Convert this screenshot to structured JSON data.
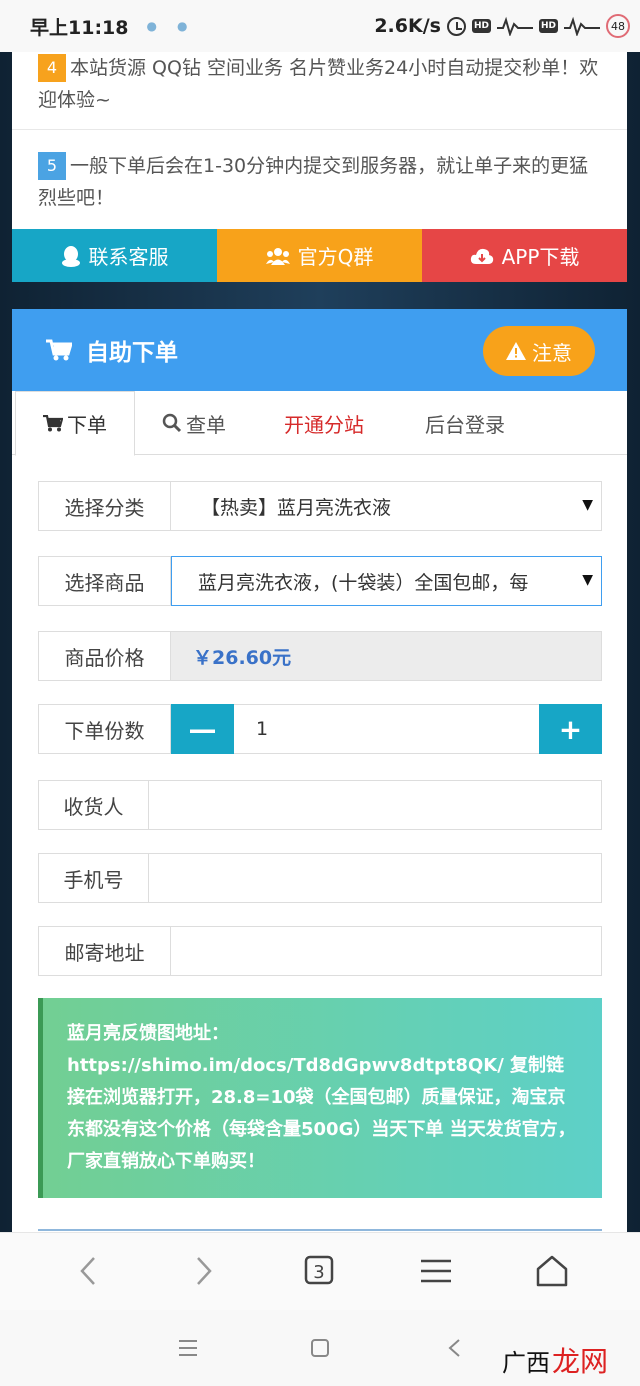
{
  "status_bar": {
    "time": "早上11:18",
    "net_speed": "2.6K/s",
    "hd1": "HD",
    "hd2": "HD",
    "battery": "48"
  },
  "notices": [
    {
      "num": "4",
      "text": "本站货源 QQ钻 空间业务 名片赞业务24小时自动提交秒单！欢迎体验~"
    },
    {
      "num": "5",
      "text": "一般下单后会在1-30分钟内提交到服务器，就让单子来的更猛烈些吧！"
    }
  ],
  "actions": {
    "contact": "联系客服",
    "qq_group": "官方Q群",
    "app_download": "APP下载"
  },
  "order": {
    "header_title": "自助下单",
    "notice_button": "注意",
    "tabs": {
      "order": "下单",
      "query": "查单",
      "open_site": "开通分站",
      "admin": "后台登录"
    },
    "fields": {
      "category_label": "选择分类",
      "category_value": "【热卖】蓝月亮洗衣液",
      "product_label": "选择商品",
      "product_value": "蓝月亮洗衣液，(十袋装）全国包邮，每",
      "price_label": "商品价格",
      "price_value": "￥26.60元",
      "qty_label": "下单份数",
      "qty_value": "1",
      "qty_minus": "—",
      "qty_plus": "+",
      "receiver_label": "收货人",
      "phone_label": "手机号",
      "address_label": "邮寄地址"
    },
    "info_title": "蓝月亮反馈图地址：",
    "info_body": "https://shimo.im/docs/Td8dGpwv8dtpt8QK/ 复制链接在浏览器打开，28.8=10袋（全国包邮）质量保证，淘宝京东都没有这个价格（每袋含量500G）当天下单 当天发货官方，厂家直销放心下单购买！"
  },
  "browser": {
    "tab_count": "3"
  },
  "watermark": {
    "part1": "广西",
    "part2": "龙网"
  },
  "colors": {
    "primary_blue": "#3f9ef0",
    "teal": "#17a6c6",
    "orange": "#f8a21a",
    "red": "#e64646"
  }
}
